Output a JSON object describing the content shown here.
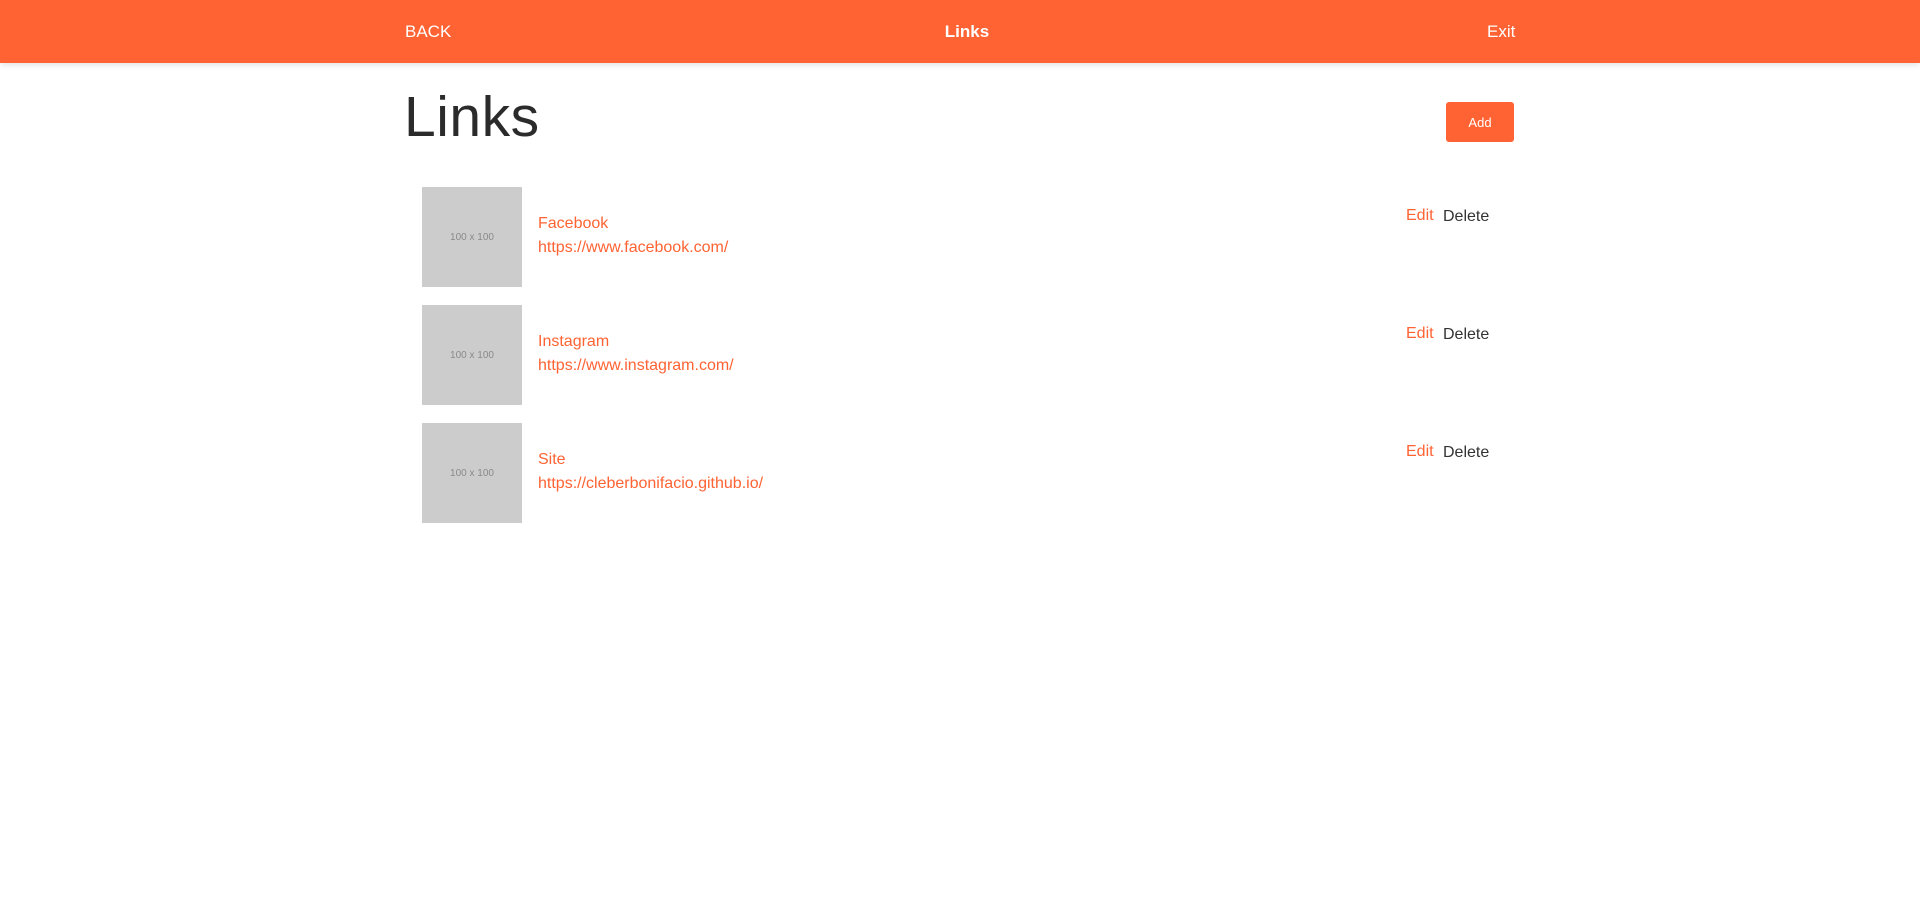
{
  "header": {
    "back_label": "BACK",
    "title": "Links",
    "exit_label": "Exit"
  },
  "main": {
    "title": "Links",
    "add_label": "Add",
    "links": [
      {
        "thumb": "100 x 100",
        "name": "Facebook",
        "url": "https://www.facebook.com/",
        "edit_label": "Edit",
        "delete_label": "Delete"
      },
      {
        "thumb": "100 x 100",
        "name": "Instagram",
        "url": "https://www.instagram.com/",
        "edit_label": "Edit",
        "delete_label": "Delete"
      },
      {
        "thumb": "100 x 100",
        "name": "Site",
        "url": "https://cleberbonifacio.github.io/",
        "edit_label": "Edit",
        "delete_label": "Delete"
      }
    ]
  },
  "colors": {
    "accent": "#ff6333",
    "thumb_bg": "#cccccc",
    "text_dark": "#2b2b2b"
  }
}
